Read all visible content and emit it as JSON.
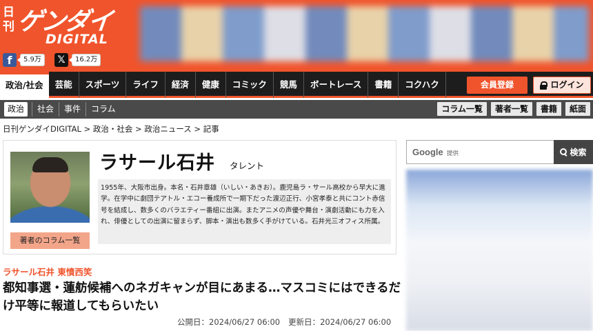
{
  "header": {
    "logo_small": "日刊",
    "logo_main": "ゲンダイ",
    "logo_sub": "DIGITAL",
    "social": {
      "facebook_count": "5.9万",
      "x_count": "16.2万"
    }
  },
  "nav": {
    "items": [
      "政治/社会",
      "芸能",
      "スポーツ",
      "ライフ",
      "経済",
      "健康",
      "コミック",
      "競馬",
      "ボートレース",
      "書籍",
      "コクハク"
    ],
    "member_label": "会員登録",
    "login_label": "ログイン"
  },
  "subnav": {
    "items": [
      "政治",
      "社会",
      "事件",
      "コラム"
    ],
    "buttons": [
      "コラム一覧",
      "著者一覧",
      "書籍",
      "紙面"
    ]
  },
  "breadcrumb": "日刊ゲンダイDIGITAL > 政治・社会 > 政治ニュース > 記事",
  "author": {
    "name": "ラサール石井",
    "role": "タレント",
    "bio": "1955年、大阪市出身。本名・石井章雄（いしい・あきお）。鹿児島ラ・サール高校から早大に進学。在学中に劇団テアトル・エコー養成所で一期下だった渡辺正行、小宮孝泰と共にコント赤信号を結成し、数多くのバラエティー番組に出演。またアニメの声優や舞台・演劇活動にも力を入れ、俳優としての出演に留まらず、脚本・演出も数多く手がけている。石井光三オフィス所属。",
    "column_button": "著者のコラム一覧"
  },
  "article": {
    "kicker": "ラサール石井 東憤西笑",
    "headline": "都知事選・蓮舫候補へのネガキャンが目にあまる…マスコミにはできるだけ平等に報道してもらいたい",
    "published": "公開日：2024/06/27 06:00",
    "updated": "更新日：2024/06/27 06:00"
  },
  "sidebar": {
    "search_logo": "Google",
    "search_sub": "提供",
    "search_button": "検索"
  },
  "colors": {
    "brand": "#f0542c",
    "nav_bg": "#1d1d1d",
    "subnav_bg": "#4a4a4a"
  }
}
